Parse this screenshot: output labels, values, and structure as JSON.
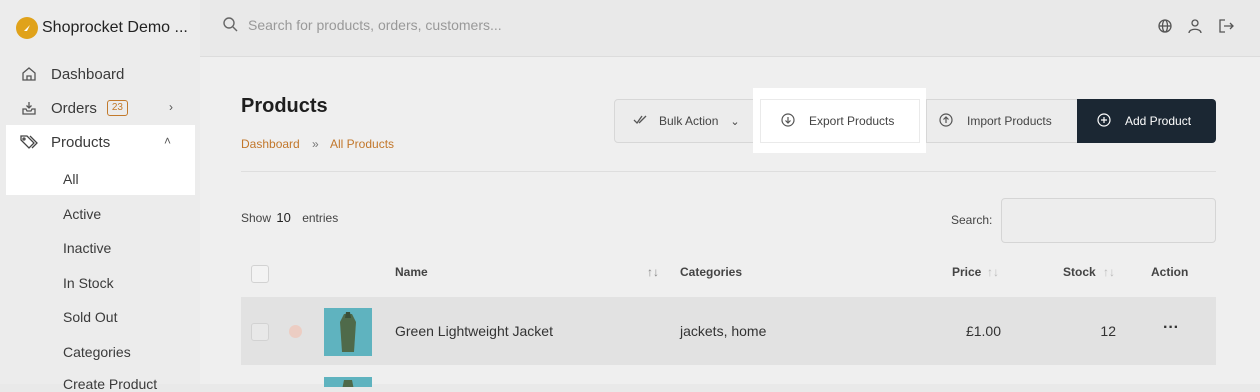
{
  "brand": {
    "name": "Shoprocket Demo ..."
  },
  "sidebar": {
    "items": [
      {
        "label": "Dashboard"
      },
      {
        "label": "Orders",
        "badge": "23"
      },
      {
        "label": "Products"
      }
    ],
    "sub_items": [
      "All",
      "Active",
      "Inactive",
      "In Stock",
      "Sold Out",
      "Categories",
      "Create Product"
    ]
  },
  "search": {
    "placeholder": "Search for products, orders, customers..."
  },
  "page": {
    "title": "Products",
    "breadcrumb": [
      "Dashboard",
      "»",
      "All Products"
    ]
  },
  "toolbar": {
    "bulk_action": "Bulk Action",
    "export": "Export Products",
    "import": "Import Products",
    "add": "Add Product"
  },
  "table": {
    "show_label": "Show",
    "show_value": "10",
    "entries_label": "entries",
    "search_label": "Search:",
    "columns": {
      "name": "Name",
      "categories": "Categories",
      "price": "Price",
      "stock": "Stock",
      "action": "Action"
    },
    "rows": [
      {
        "name": "Green Lightweight Jacket",
        "categories": "jackets, home",
        "price": "£1.00",
        "stock": "12",
        "action": "···"
      }
    ]
  },
  "colors": {
    "accent": "#c2772b",
    "brand": "#e0a21a",
    "dark_button": "#1b2733"
  }
}
